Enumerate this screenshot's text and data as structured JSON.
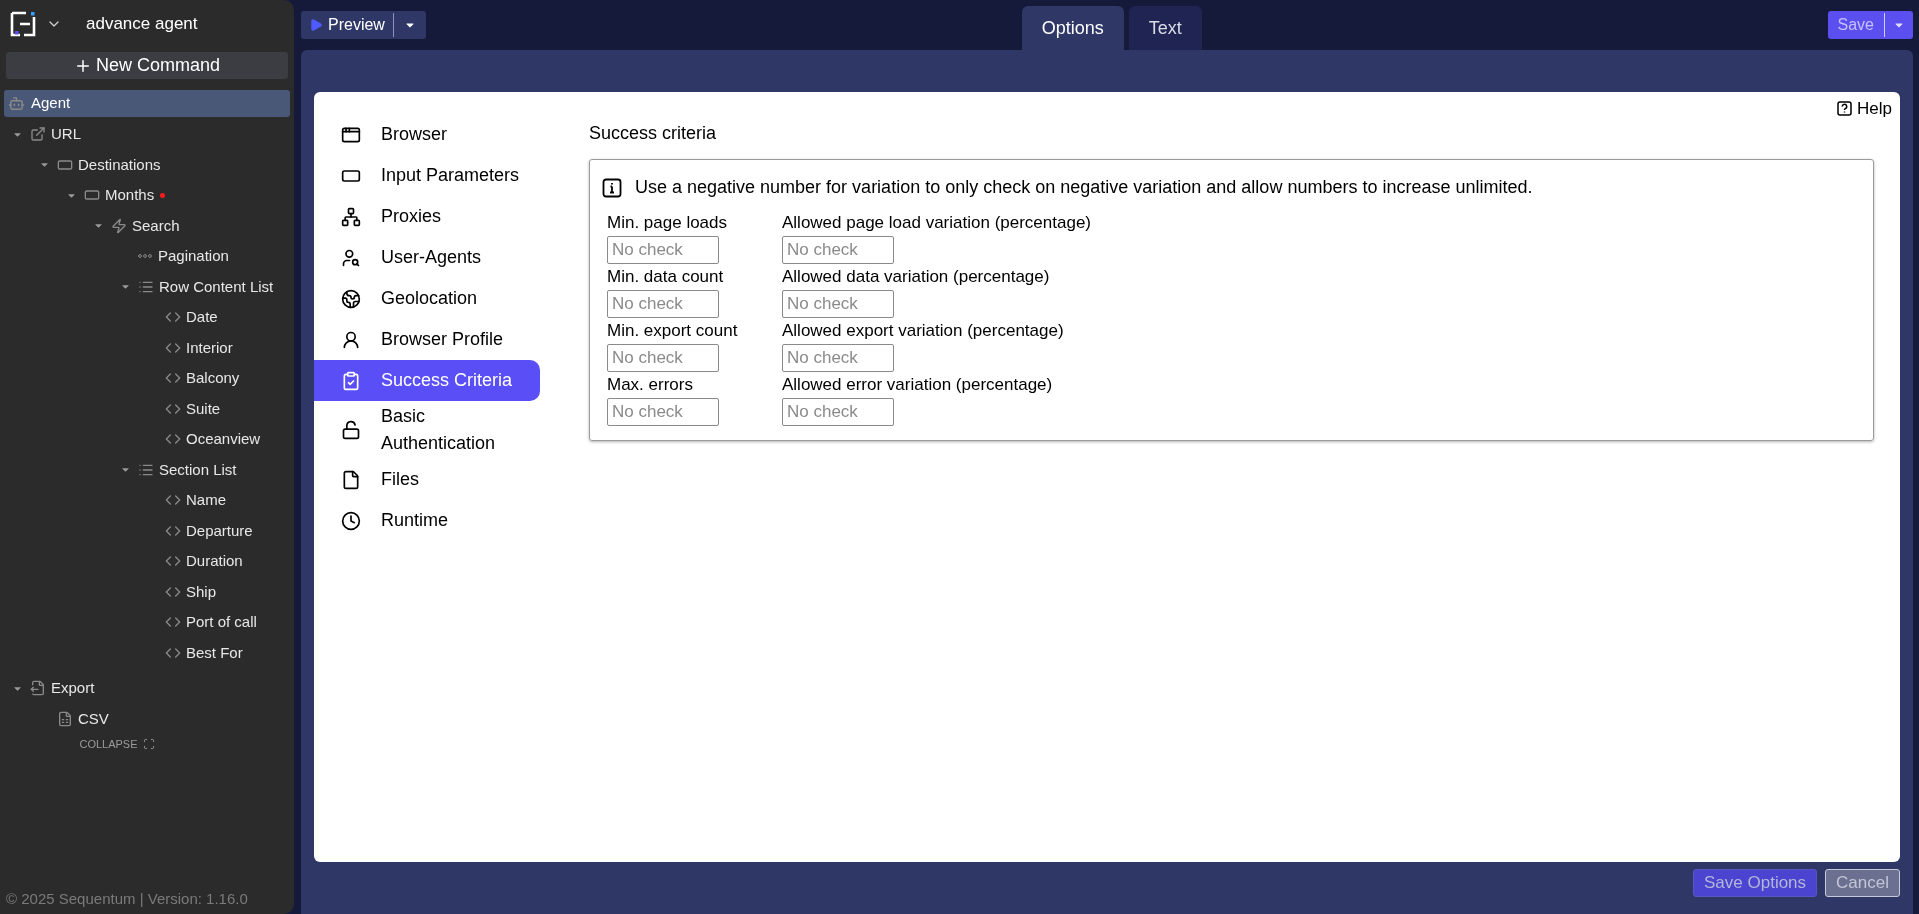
{
  "app": {
    "title": "advance agent",
    "new_command": "New Command"
  },
  "agent": {
    "label": "Agent",
    "selected": true
  },
  "tree": [
    {
      "label": "URL",
      "kind": "url",
      "selected": false,
      "expanded": true,
      "modified": false,
      "children": [
        {
          "label": "Destinations",
          "kind": "loop",
          "selected": false,
          "expanded": true,
          "modified": false,
          "children": [
            {
              "label": "Months",
              "kind": "loop",
              "selected": false,
              "expanded": true,
              "modified": true,
              "children": [
                {
                  "label": "Search",
                  "kind": "action",
                  "selected": false,
                  "expanded": true,
                  "modified": false,
                  "children": [
                    {
                      "label": "Pagination",
                      "kind": "pagination",
                      "selected": false,
                      "modified": false
                    },
                    {
                      "label": "Row Content List",
                      "kind": "list",
                      "selected": false,
                      "expanded": true,
                      "modified": false,
                      "children": [
                        {
                          "label": "Date",
                          "kind": "capture",
                          "selected": false,
                          "modified": false
                        },
                        {
                          "label": "Interior",
                          "kind": "capture",
                          "selected": false,
                          "modified": false
                        },
                        {
                          "label": "Balcony",
                          "kind": "capture",
                          "selected": false,
                          "modified": false
                        },
                        {
                          "label": "Suite",
                          "kind": "capture",
                          "selected": false,
                          "modified": false
                        },
                        {
                          "label": "Oceanview",
                          "kind": "capture",
                          "selected": false,
                          "modified": false
                        }
                      ]
                    },
                    {
                      "label": "Section List",
                      "kind": "list",
                      "selected": false,
                      "expanded": true,
                      "modified": false,
                      "children": [
                        {
                          "label": "Name",
                          "kind": "capture",
                          "selected": false,
                          "modified": false
                        },
                        {
                          "label": "Departure",
                          "kind": "capture",
                          "selected": false,
                          "modified": false
                        },
                        {
                          "label": "Duration",
                          "kind": "capture",
                          "selected": false,
                          "modified": false
                        },
                        {
                          "label": "Ship",
                          "kind": "capture",
                          "selected": false,
                          "modified": false
                        },
                        {
                          "label": "Port of call",
                          "kind": "capture",
                          "selected": false,
                          "modified": false
                        },
                        {
                          "label": "Best For",
                          "kind": "capture",
                          "selected": false,
                          "modified": false
                        }
                      ]
                    }
                  ]
                }
              ]
            }
          ]
        }
      ]
    },
    {
      "label": "Export",
      "kind": "export",
      "selected": false,
      "expanded": true,
      "modified": false,
      "children": [
        {
          "label": "CSV",
          "kind": "csv",
          "selected": false,
          "modified": false
        }
      ]
    }
  ],
  "collapse": "COLLAPSE",
  "footer": "© 2025 Sequentum | Version: 1.16.0",
  "toolbar": {
    "preview": "Preview",
    "save": "Save"
  },
  "tabs": [
    {
      "label": "Options",
      "selected": true
    },
    {
      "label": "Text",
      "selected": false
    }
  ],
  "help": "Help",
  "nav": [
    {
      "label": "Browser",
      "kind": "browser",
      "selected": false
    },
    {
      "label": "Input Parameters",
      "kind": "input",
      "selected": false
    },
    {
      "label": "Proxies",
      "kind": "proxies",
      "selected": false
    },
    {
      "label": "User-Agents",
      "kind": "agents",
      "selected": false
    },
    {
      "label": "Geolocation",
      "kind": "geo",
      "selected": false
    },
    {
      "label": "Browser Profile",
      "kind": "profile",
      "selected": false
    },
    {
      "label": "Success Criteria",
      "kind": "criteria",
      "selected": true
    },
    {
      "label": "Basic Authentication",
      "kind": "auth",
      "selected": false
    },
    {
      "label": "Files",
      "kind": "files",
      "selected": false
    },
    {
      "label": "Runtime",
      "kind": "runtime",
      "selected": false
    }
  ],
  "section": {
    "title": "Success criteria",
    "info": "Use a negative number for variation to only check on negative variation and allow numbers to increase unlimited.",
    "rows": [
      {
        "label": "Min. page loads",
        "placeholder": "No check",
        "variation_label": "Allowed page load variation (percentage)",
        "variation_placeholder": "No check"
      },
      {
        "label": "Min. data count",
        "placeholder": "No check",
        "variation_label": "Allowed data variation (percentage)",
        "variation_placeholder": "No check"
      },
      {
        "label": "Min. export count",
        "placeholder": "No check",
        "variation_label": "Allowed export variation (percentage)",
        "variation_placeholder": "No check"
      },
      {
        "label": "Max. errors",
        "placeholder": "No check",
        "variation_label": "Allowed error variation (percentage)",
        "variation_placeholder": "No check"
      }
    ]
  },
  "buttons": [
    {
      "label": "Save Options",
      "kind": "primary",
      "disabled": false
    },
    {
      "label": "Cancel",
      "kind": "secondary",
      "disabled": true
    }
  ]
}
